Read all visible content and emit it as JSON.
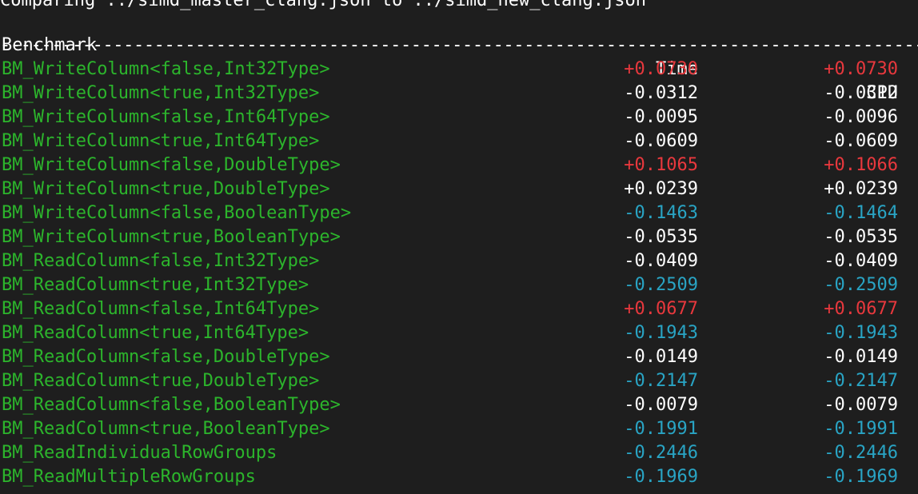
{
  "terminal": {
    "command_line": "Comparing ../simd_master_clang.json to ../simd_new_clang.json",
    "headers": {
      "name": "Benchmark",
      "time": "Time",
      "cpu": "CPU"
    },
    "separator": "-----------------------------------------------------------------------------------------------",
    "colors": {
      "name": "#2cb52c",
      "white": "#ffffff",
      "red": "#e8383d",
      "cyan": "#29a4c4",
      "background": "#1e1e1e"
    },
    "rows": [
      {
        "name": "BM_WriteColumn<false,Int32Type>",
        "time": "+0.0730",
        "cpu": "+0.0730",
        "time_color": "red",
        "cpu_color": "red"
      },
      {
        "name": "BM_WriteColumn<true,Int32Type>",
        "time": "-0.0312",
        "cpu": "-0.0312",
        "time_color": "white",
        "cpu_color": "white"
      },
      {
        "name": "BM_WriteColumn<false,Int64Type>",
        "time": "-0.0095",
        "cpu": "-0.0096",
        "time_color": "white",
        "cpu_color": "white"
      },
      {
        "name": "BM_WriteColumn<true,Int64Type>",
        "time": "-0.0609",
        "cpu": "-0.0609",
        "time_color": "white",
        "cpu_color": "white"
      },
      {
        "name": "BM_WriteColumn<false,DoubleType>",
        "time": "+0.1065",
        "cpu": "+0.1066",
        "time_color": "red",
        "cpu_color": "red"
      },
      {
        "name": "BM_WriteColumn<true,DoubleType>",
        "time": "+0.0239",
        "cpu": "+0.0239",
        "time_color": "white",
        "cpu_color": "white"
      },
      {
        "name": "BM_WriteColumn<false,BooleanType>",
        "time": "-0.1463",
        "cpu": "-0.1464",
        "time_color": "cyan",
        "cpu_color": "cyan"
      },
      {
        "name": "BM_WriteColumn<true,BooleanType>",
        "time": "-0.0535",
        "cpu": "-0.0535",
        "time_color": "white",
        "cpu_color": "white"
      },
      {
        "name": "BM_ReadColumn<false,Int32Type>",
        "time": "-0.0409",
        "cpu": "-0.0409",
        "time_color": "white",
        "cpu_color": "white"
      },
      {
        "name": "BM_ReadColumn<true,Int32Type>",
        "time": "-0.2509",
        "cpu": "-0.2509",
        "time_color": "cyan",
        "cpu_color": "cyan"
      },
      {
        "name": "BM_ReadColumn<false,Int64Type>",
        "time": "+0.0677",
        "cpu": "+0.0677",
        "time_color": "red",
        "cpu_color": "red"
      },
      {
        "name": "BM_ReadColumn<true,Int64Type>",
        "time": "-0.1943",
        "cpu": "-0.1943",
        "time_color": "cyan",
        "cpu_color": "cyan"
      },
      {
        "name": "BM_ReadColumn<false,DoubleType>",
        "time": "-0.0149",
        "cpu": "-0.0149",
        "time_color": "white",
        "cpu_color": "white"
      },
      {
        "name": "BM_ReadColumn<true,DoubleType>",
        "time": "-0.2147",
        "cpu": "-0.2147",
        "time_color": "cyan",
        "cpu_color": "cyan"
      },
      {
        "name": "BM_ReadColumn<false,BooleanType>",
        "time": "-0.0079",
        "cpu": "-0.0079",
        "time_color": "white",
        "cpu_color": "white"
      },
      {
        "name": "BM_ReadColumn<true,BooleanType>",
        "time": "-0.1991",
        "cpu": "-0.1991",
        "time_color": "cyan",
        "cpu_color": "cyan"
      },
      {
        "name": "BM_ReadIndividualRowGroups",
        "time": "-0.2446",
        "cpu": "-0.2446",
        "time_color": "cyan",
        "cpu_color": "cyan"
      },
      {
        "name": "BM_ReadMultipleRowGroups",
        "time": "-0.1969",
        "cpu": "-0.1969",
        "time_color": "cyan",
        "cpu_color": "cyan"
      }
    ]
  }
}
